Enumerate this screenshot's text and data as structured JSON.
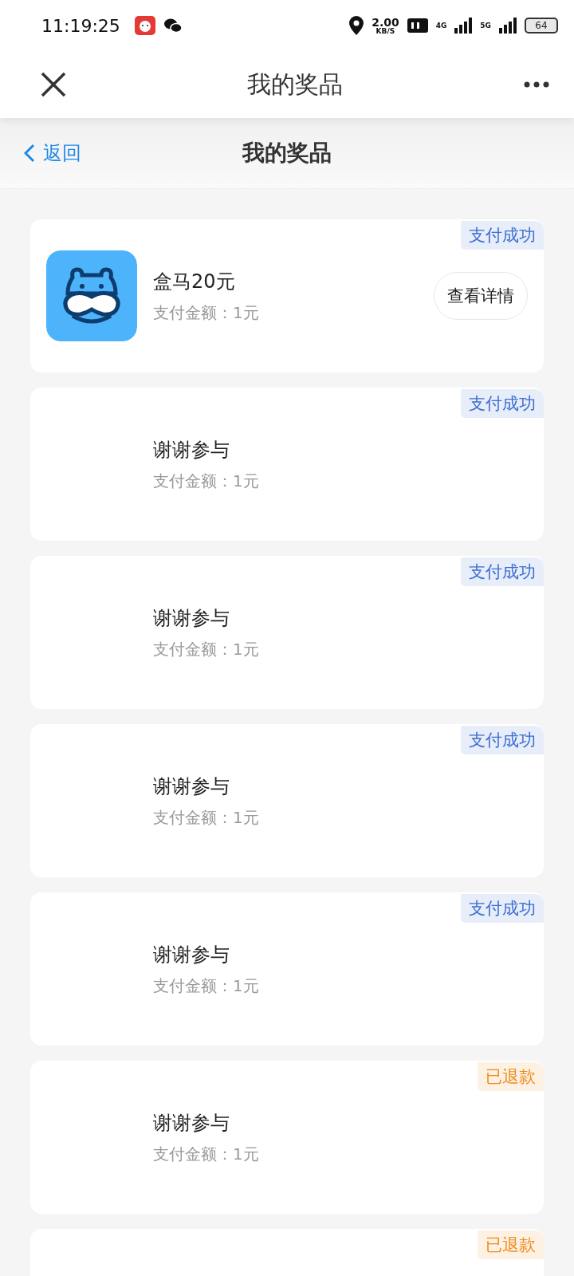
{
  "status_bar": {
    "time": "11:19:25",
    "speed": "2.00",
    "speed_unit": "KB/S",
    "network_1": "4G",
    "network_2": "5G",
    "battery": "64"
  },
  "app_bar": {
    "title": "我的奖品"
  },
  "header": {
    "back": "返回",
    "title": "我的奖品"
  },
  "prizes": [
    {
      "kind": "prize",
      "title": "盒马20元",
      "amount": "支付金额：1元",
      "status": "支付成功",
      "color": "#3d6fd1",
      "button": "查看详情"
    },
    {
      "kind": "plain",
      "title": "谢谢参与",
      "amount": "支付金额：1元",
      "status": "支付成功",
      "color": "#3d6fd1"
    },
    {
      "kind": "plain",
      "title": "谢谢参与",
      "amount": "支付金额：1元",
      "status": "支付成功",
      "color": "#3d6fd1"
    },
    {
      "kind": "plain",
      "title": "谢谢参与",
      "amount": "支付金额：1元",
      "status": "支付成功",
      "color": "#3d6fd1"
    },
    {
      "kind": "plain",
      "title": "谢谢参与",
      "amount": "支付金额：1元",
      "status": "支付成功",
      "color": "#3d6fd1"
    },
    {
      "kind": "plain",
      "title": "谢谢参与",
      "amount": "支付金额：1元",
      "status": "已退款",
      "color": "#ef8a1c"
    },
    {
      "kind": "cut",
      "status": "已退款",
      "color": "#ef8a1c"
    }
  ]
}
